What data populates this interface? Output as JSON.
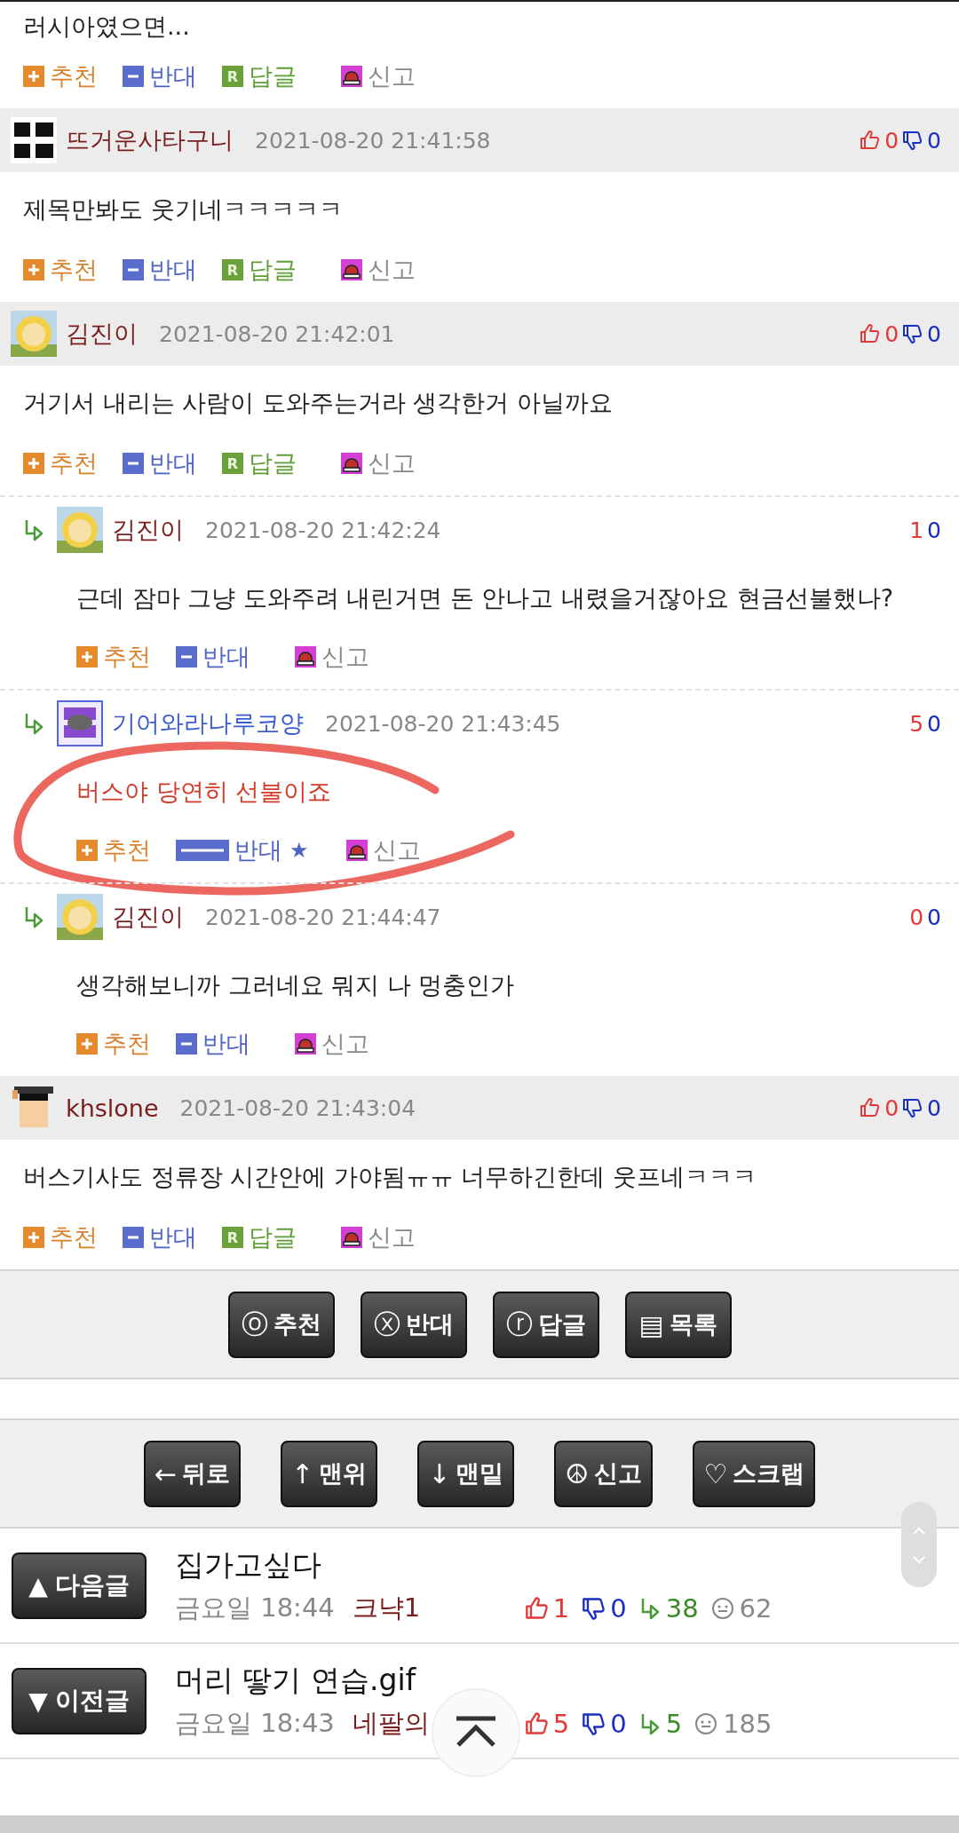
{
  "partial_comment": {
    "body": "러시아였으면...",
    "actions": [
      {
        "kind": "recommend",
        "label": "추천"
      },
      {
        "kind": "oppose",
        "label": "반대"
      },
      {
        "kind": "reply",
        "label": "답글",
        "badge": "R"
      },
      {
        "kind": "report",
        "label": "신고"
      }
    ]
  },
  "comments": [
    {
      "author": "뜨거운사타구니",
      "avatar": {
        "kind": "letters"
      },
      "time": "2021-08-20 21:41:58",
      "up": "0",
      "down": "0",
      "body": "제목만봐도 웃기네ㅋㅋㅋㅋㅋ",
      "actions": [
        {
          "kind": "recommend",
          "label": "추천"
        },
        {
          "kind": "oppose",
          "label": "반대"
        },
        {
          "kind": "reply",
          "label": "답글",
          "badge": "R"
        },
        {
          "kind": "report",
          "label": "신고"
        }
      ]
    },
    {
      "author": "김진이",
      "avatar": {
        "kind": "sun"
      },
      "time": "2021-08-20 21:42:01",
      "up": "0",
      "down": "0",
      "body": "거기서 내리는 사람이 도와주는거라 생각한거 아닐까요",
      "actions": [
        {
          "kind": "recommend",
          "label": "추천"
        },
        {
          "kind": "oppose",
          "label": "반대"
        },
        {
          "kind": "reply",
          "label": "답글",
          "badge": "R"
        },
        {
          "kind": "report",
          "label": "신고"
        }
      ],
      "replies": [
        {
          "author": "김진이",
          "avatar": {
            "kind": "sun"
          },
          "time": "2021-08-20 21:42:24",
          "up": "1",
          "down": "0",
          "highlighted": false,
          "body": "근데 잠마 그냥 도와주려 내린거면 돈 안나고 내렸을거잖아요 현금선불했나?",
          "actions": [
            {
              "kind": "recommend",
              "label": "추천"
            },
            {
              "kind": "oppose",
              "label": "반대"
            },
            {
              "kind": "report",
              "label": "신고"
            }
          ]
        },
        {
          "author": "기어와라나루코양",
          "avatar": {
            "kind": "tile"
          },
          "time": "2021-08-20 21:43:45",
          "up": "5",
          "down": "0",
          "highlighted": true,
          "body": "버스야 당연히 선불이죠",
          "actions": [
            {
              "kind": "recommend",
              "label": "추천"
            },
            {
              "kind": "oppose",
              "label": "반대",
              "mark": "★"
            },
            {
              "kind": "report",
              "label": "신고"
            }
          ]
        },
        {
          "author": "김진이",
          "avatar": {
            "kind": "sun"
          },
          "time": "2021-08-20 21:44:47",
          "up": "0",
          "down": "0",
          "highlighted": false,
          "body": "생각해보니까 그러네요 뭐지 나 멍충인가",
          "actions": [
            {
              "kind": "recommend",
              "label": "추천"
            },
            {
              "kind": "oppose",
              "label": "반대"
            },
            {
              "kind": "report",
              "label": "신고"
            }
          ]
        }
      ]
    },
    {
      "author": "khslone",
      "avatar": {
        "kind": "pixel"
      },
      "time": "2021-08-20 21:43:04",
      "up": "0",
      "down": "0",
      "body": "버스기사도 정류장 시간안에 가야됨ㅠㅠ 너무하긴한데 웃프네ㅋㅋㅋ",
      "actions": [
        {
          "kind": "recommend",
          "label": "추천"
        },
        {
          "kind": "oppose",
          "label": "반대"
        },
        {
          "kind": "reply",
          "label": "답글",
          "badge": "R"
        },
        {
          "kind": "report",
          "label": "신고"
        }
      ]
    }
  ],
  "comment_toolbar": [
    {
      "icon": "ⓞ",
      "label": "추천"
    },
    {
      "icon": "ⓧ",
      "label": "반대"
    },
    {
      "icon": "ⓡ",
      "label": "답글"
    },
    {
      "icon": "▤",
      "label": "목록"
    }
  ],
  "page_toolbar": [
    {
      "icon": "←",
      "label": "뒤로"
    },
    {
      "icon": "↑",
      "label": "맨위"
    },
    {
      "icon": "↓",
      "label": "맨밑"
    },
    {
      "icon": "☮",
      "label": "신고"
    },
    {
      "icon": "♡",
      "label": "스크랩"
    }
  ],
  "post_nav": [
    {
      "icon": "▲",
      "label": "다음글",
      "title": "집가고싶다",
      "time": "금요일 18:44",
      "author": "크냑1",
      "up": "1",
      "down": "0",
      "replies": "38",
      "views": "62"
    },
    {
      "icon": "▼",
      "label": "이전글",
      "title": "머리 땋기 연습.gif",
      "time": "금요일 18:43",
      "author": "네팔의",
      "up": "5",
      "down": "0",
      "replies": "5",
      "views": "185"
    }
  ]
}
